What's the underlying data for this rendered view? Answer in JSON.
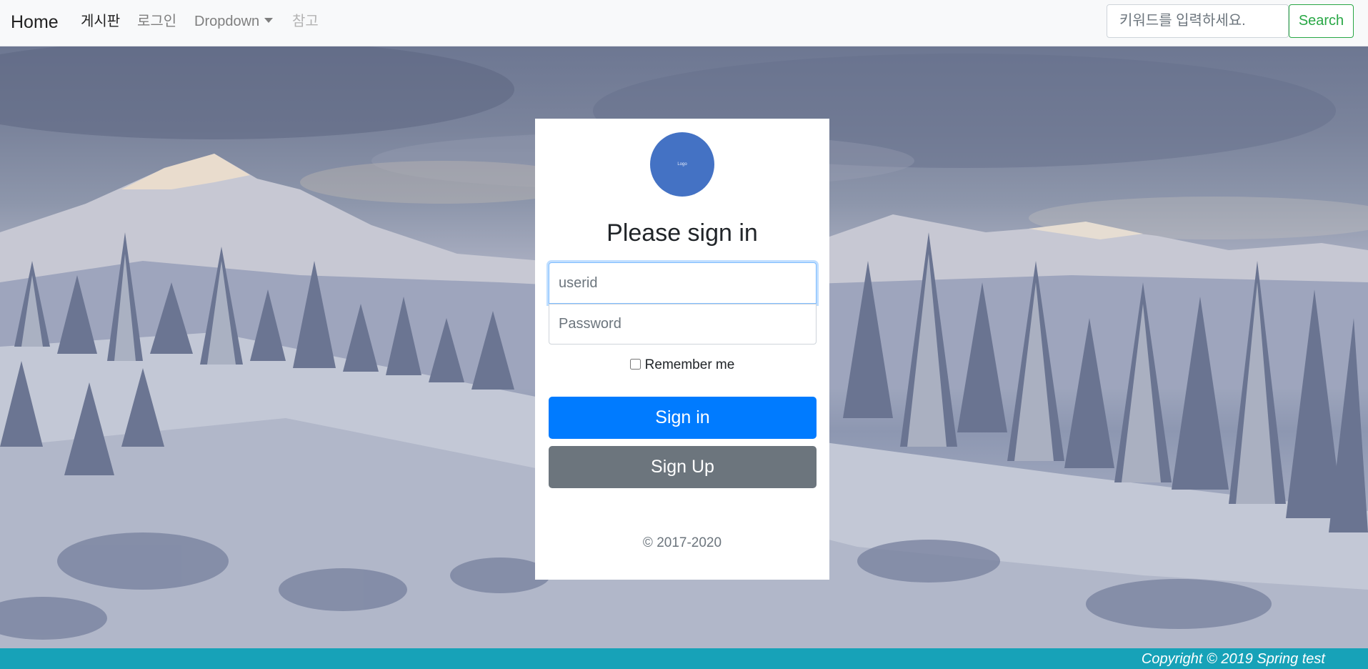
{
  "navbar": {
    "brand": "Home",
    "items": [
      {
        "label": "게시판",
        "state": "active"
      },
      {
        "label": "로그인",
        "state": "normal"
      },
      {
        "label": "Dropdown",
        "state": "normal"
      },
      {
        "label": "참고",
        "state": "disabled"
      }
    ],
    "search": {
      "placeholder": "키워드를 입력하세요.",
      "button_label": "Search"
    }
  },
  "signin": {
    "logo_text": "Logo",
    "heading": "Please sign in",
    "userid_placeholder": "userid",
    "password_placeholder": "Password",
    "remember_label": "Remember me",
    "signin_label": "Sign in",
    "signup_label": "Sign Up",
    "copyright": "© 2017-2020"
  },
  "footer": {
    "text": "Copyright © 2019 Spring test"
  },
  "colors": {
    "primary": "#007bff",
    "secondary": "#6c757d",
    "success": "#28a745",
    "footer": "#17a2b8",
    "logo": "#4472c4"
  },
  "icons": {
    "dropdown": "caret-down-icon"
  }
}
